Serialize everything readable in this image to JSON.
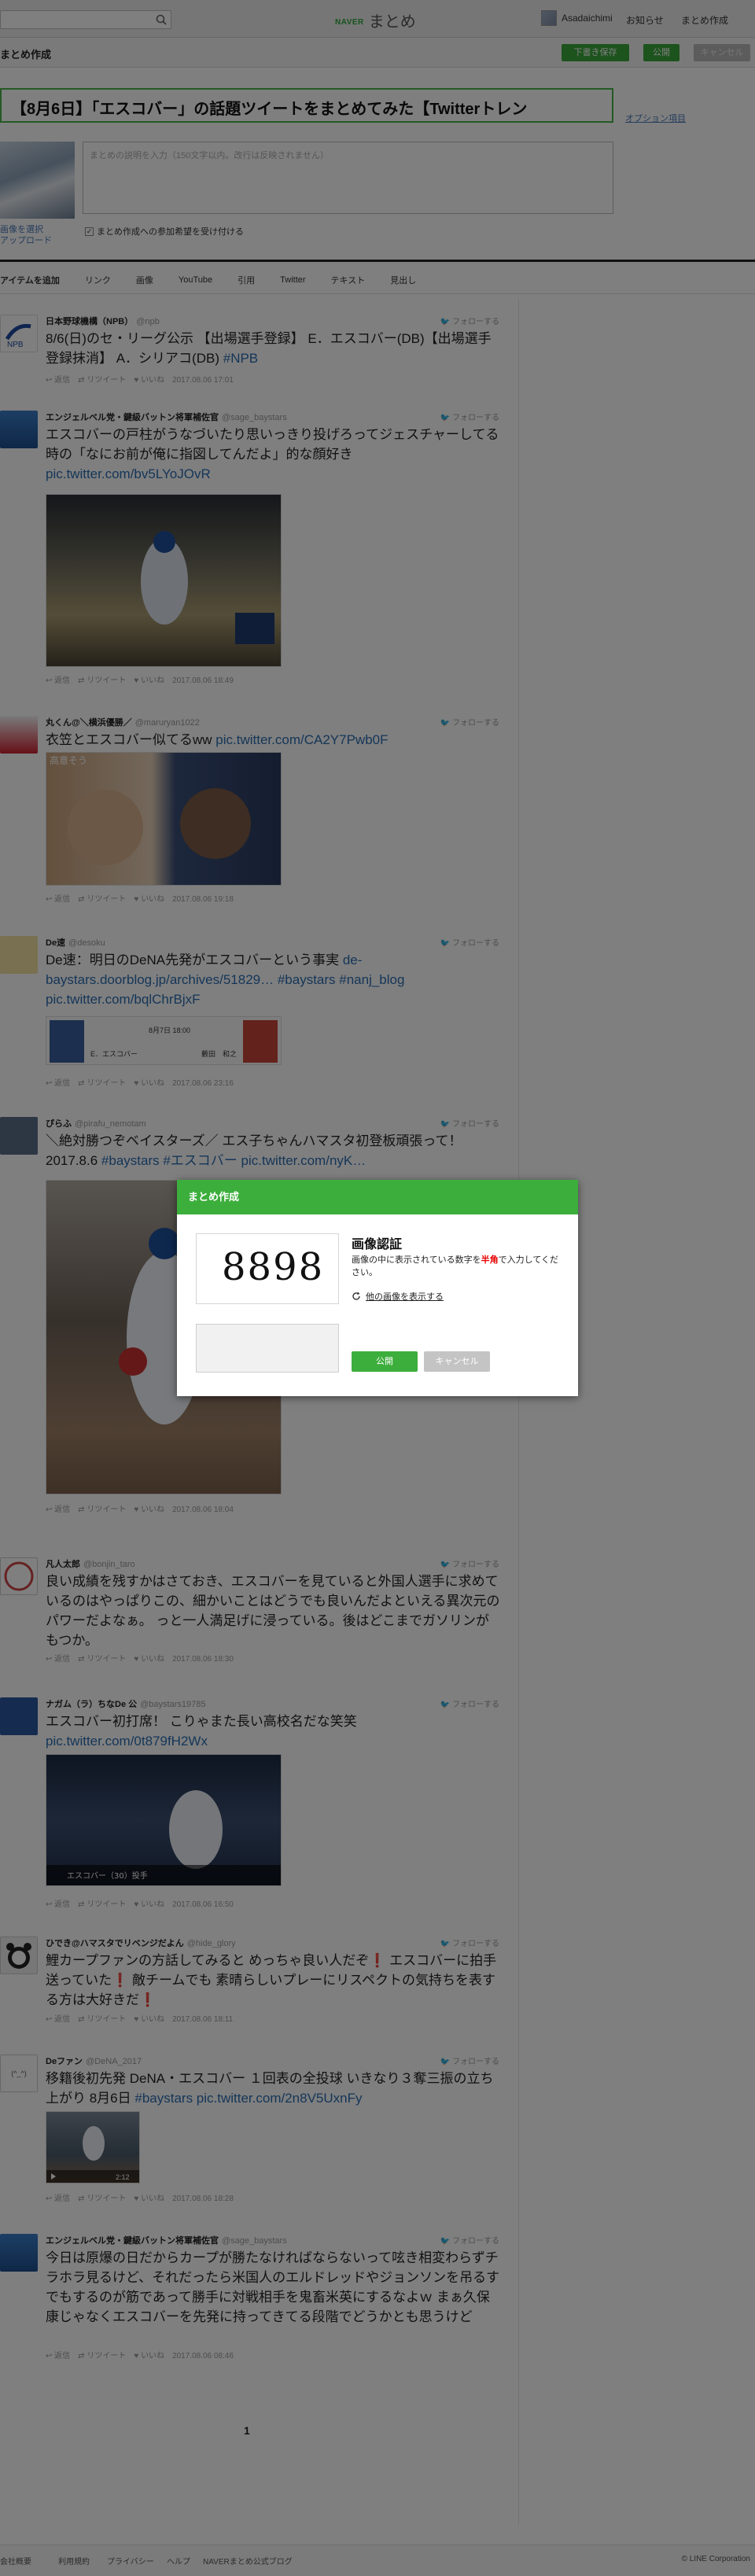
{
  "header": {
    "logo_prefix": "NAVER",
    "logo": "まとめ",
    "user_name": "Asadaichimi",
    "nav": [
      "お知らせ",
      "まとめ作成"
    ]
  },
  "toolbar": {
    "title": "まとめ作成",
    "save_draft": "下書き保存",
    "publish": "公開",
    "cancel": "キャンセル"
  },
  "editor": {
    "title_value": "【8月6日】「エスコバー」の話題ツイートをまとめてみた【Twitterトレン",
    "option_link": "オプション項目",
    "thumb_links": [
      "画像を選択",
      "アップロード"
    ],
    "description_placeholder": "まとめの説明を入力（150文字以内。改行は反映されません）",
    "checkbox_label": "まとめ作成への参加希望を受け付ける",
    "checkbox_mark": "✓"
  },
  "itembar": {
    "label": "アイテムを追加",
    "items": [
      "リンク",
      "画像",
      "YouTube",
      "引用",
      "Twitter",
      "テキスト",
      "見出し"
    ]
  },
  "tweet_labels": {
    "follow": "フォローする",
    "reply": "返信",
    "retweet": "リツイート",
    "like": "いいね"
  },
  "tweets": [
    {
      "name": "日本野球機構（NPB）",
      "screen": "@npb",
      "text": "8/6(日)のセ・リーグ公示 【出場選手登録】 E．エスコバー(DB)【出場選手登録抹消】 A．シリアコ(DB)",
      "link": "#NPB",
      "date": "2017.08.06 17:01"
    },
    {
      "name": "エンジェルベル党・鍵級バットン将軍補佐官",
      "screen": "@sage_baystars",
      "text": "エスコバーの戸柱がうなづいたり思いっきり投げろってジェスチャーしてる時の「なにお前が俺に指図してんだよ」的な顔好き",
      "link": "pic.twitter.com/bv5LYoJOvR",
      "date": "2017.08.06 18:49"
    },
    {
      "name": "丸くん@＼横浜優勝／",
      "screen": "@maruryan1022",
      "text": "衣笠とエスコバー似てるww",
      "link": "pic.twitter.com/CA2Y7Pwb0F",
      "date": "2017.08.06 19:18",
      "image_caption": "高意そう"
    },
    {
      "name": "De速",
      "screen": "@desoku",
      "text": "De速：明日のDeNA先発がエスコバーという事実",
      "link": "de-baystars.doorblog.jp/archives/51829…  #baystars #nanj_blog pic.twitter.com/bqlChrBjxF",
      "date": "2017.08.06 23:16",
      "card": {
        "left_name": "E．エスコバー",
        "vs": "8月7日 18:00",
        "right_name": "藪田　和之"
      }
    },
    {
      "name": "ぴらふ",
      "screen": "@pirafu_nemotam",
      "text": "＼絶対勝つぞベイスターズ／ エス子ちゃんハマスタ初登板頑張って！ 2017.8.6",
      "link": "#baystars #エスコバー pic.twitter.com/nyK…",
      "date": "2017.08.06 18:04"
    },
    {
      "name": "凡人太郎",
      "screen": "@bonjin_taro",
      "text": "良い成績を残すかはさておき、エスコバーを見ていると外国人選手に求めているのはやっぱりこの、細かいことはどうでも良いんだよといえる異次元のパワーだよなぁ。 っと一人満足げに浸っている。後はどこまでガソリンがもつか。",
      "link": "",
      "date": "2017.08.06 18:30"
    },
    {
      "name": "ナガム（ラ）ちなDe 公",
      "screen": "@baystars19785",
      "text": "エスコバー初打席！ こりゃまた長い高校名だな笑笑",
      "link": "pic.twitter.com/0t879fH2Wx",
      "date": "2017.08.06 16:50",
      "video_caption": "エスコバー（30）投手"
    },
    {
      "name": "ひでき@ハマスタでリベンジだよん",
      "screen": "@hide_glory",
      "text": "鯉カープファンの方話してみると めっちゃ良い人だぞ❗ エスコバーに拍手送っていた❗ 敵チームでも 素晴らしいプレーにリスペクトの気持ちを表する方は大好きだ❗",
      "link": "",
      "date": "2017.08.06 18:11"
    },
    {
      "name": "Deファン",
      "screen": "@DeNA_2017",
      "text": "移籍後初先発 DeNA・エスコバー １回表の全投球 いきなり３奪三振の立ち上がり 8月6日",
      "link": "#baystars pic.twitter.com/2n8V5UxnFy",
      "date": "2017.08.06 18:28",
      "video_time": "2:12"
    },
    {
      "name": "エンジェルベル党・鍵級バットン将軍補佐官",
      "screen": "@sage_baystars",
      "text": "今日は原爆の日だからカープが勝たなければならないって呟き相変わらずチラホラ見るけど、それだったら米国人のエルドレッドやジョンソンを吊るすでもするのが筋であって勝手に対戦相手を鬼畜米英にするなよｗ まぁ久保康じゃなくエスコバーを先発に持ってきてる段階でどうかとも思うけど",
      "link": "",
      "date": "2017.08.06 08:46"
    }
  ],
  "pager": "1",
  "footer": {
    "links": [
      "会社概要",
      "利用規約",
      "プライバシー",
      "ヘルプ",
      "NAVERまとめ公式ブログ"
    ],
    "copyright": "© LINE Corporation"
  },
  "modal": {
    "header": "まとめ作成",
    "captcha_digits": "8898",
    "title": "画像認証",
    "desc_before": "画像の中に表示されている数字を",
    "desc_emph": "半角",
    "desc_after": "で入力してください。",
    "refresh_label": "他の画像を表示する",
    "publish": "公開",
    "cancel": "キャンセル"
  },
  "colors": {
    "accent": "#3cae3c",
    "link": "#2b6cb0",
    "emph": "#e60000"
  }
}
